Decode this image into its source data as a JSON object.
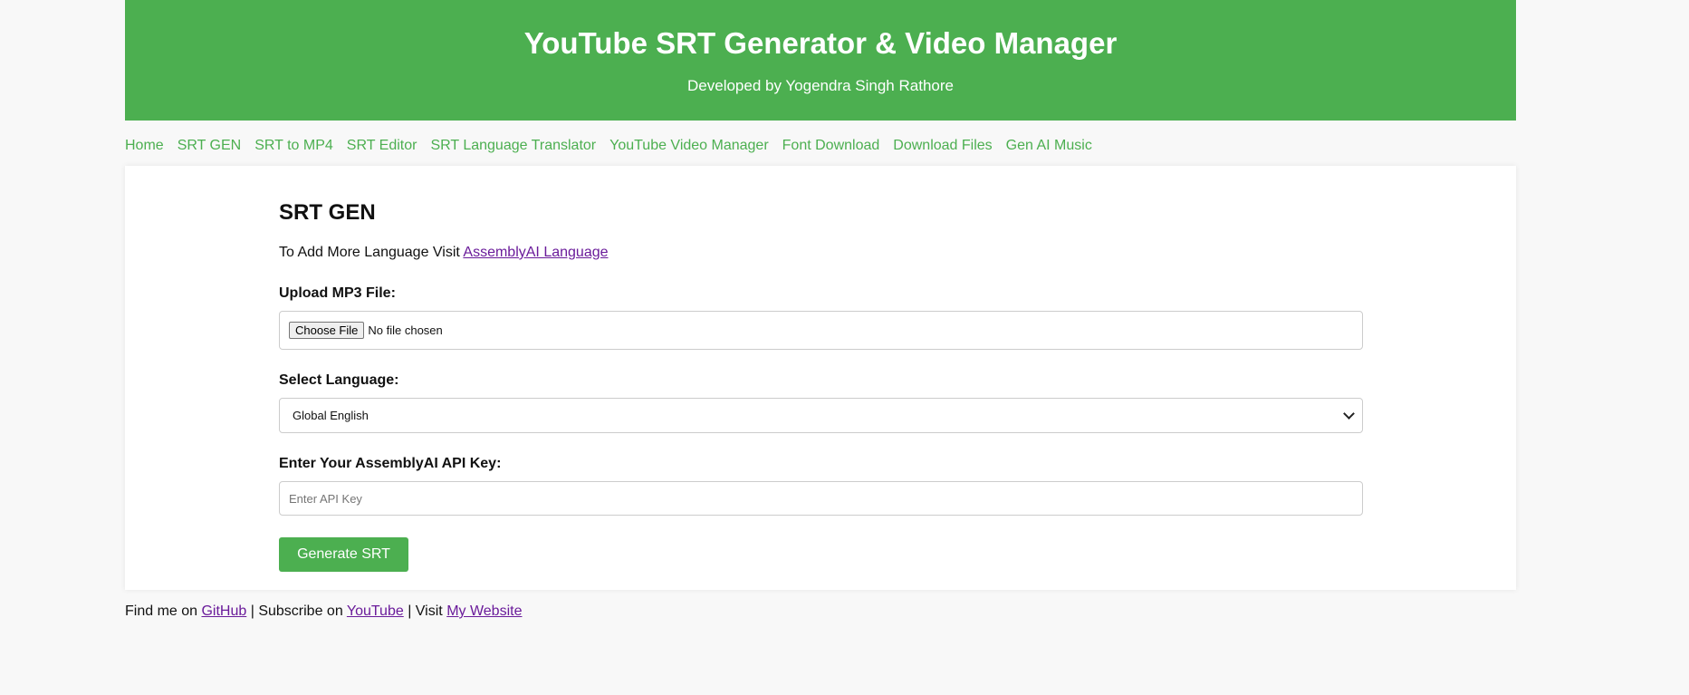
{
  "header": {
    "title": "YouTube SRT Generator & Video Manager",
    "subtitle": "Developed by Yogendra Singh Rathore"
  },
  "nav": {
    "items": [
      "Home",
      "SRT GEN",
      "SRT to MP4",
      "SRT Editor",
      "SRT Language Translator",
      "YouTube Video Manager",
      "Font Download",
      "Download Files",
      "Gen AI Music"
    ]
  },
  "form": {
    "heading": "SRT GEN",
    "info_text": "To Add More Language Visit ",
    "info_link": "AssemblyAI Language",
    "upload_label": "Upload MP3 File:",
    "choose_file_label": "Choose File",
    "file_status": "No file chosen",
    "language_label": "Select Language:",
    "language_selected": "Global English",
    "api_label": "Enter Your AssemblyAI API Key:",
    "api_placeholder": "Enter API Key",
    "api_value": "",
    "generate_label": "Generate SRT"
  },
  "footer": {
    "find_text": "Find me on ",
    "github_link": "GitHub",
    "sep1": " | Subscribe on ",
    "youtube_link": "YouTube",
    "sep2": " | Visit ",
    "website_link": "My Website"
  },
  "colors": {
    "brand_green": "#4caf50",
    "link_purple": "#6a1b9a",
    "page_background": "#f8f8f8"
  }
}
